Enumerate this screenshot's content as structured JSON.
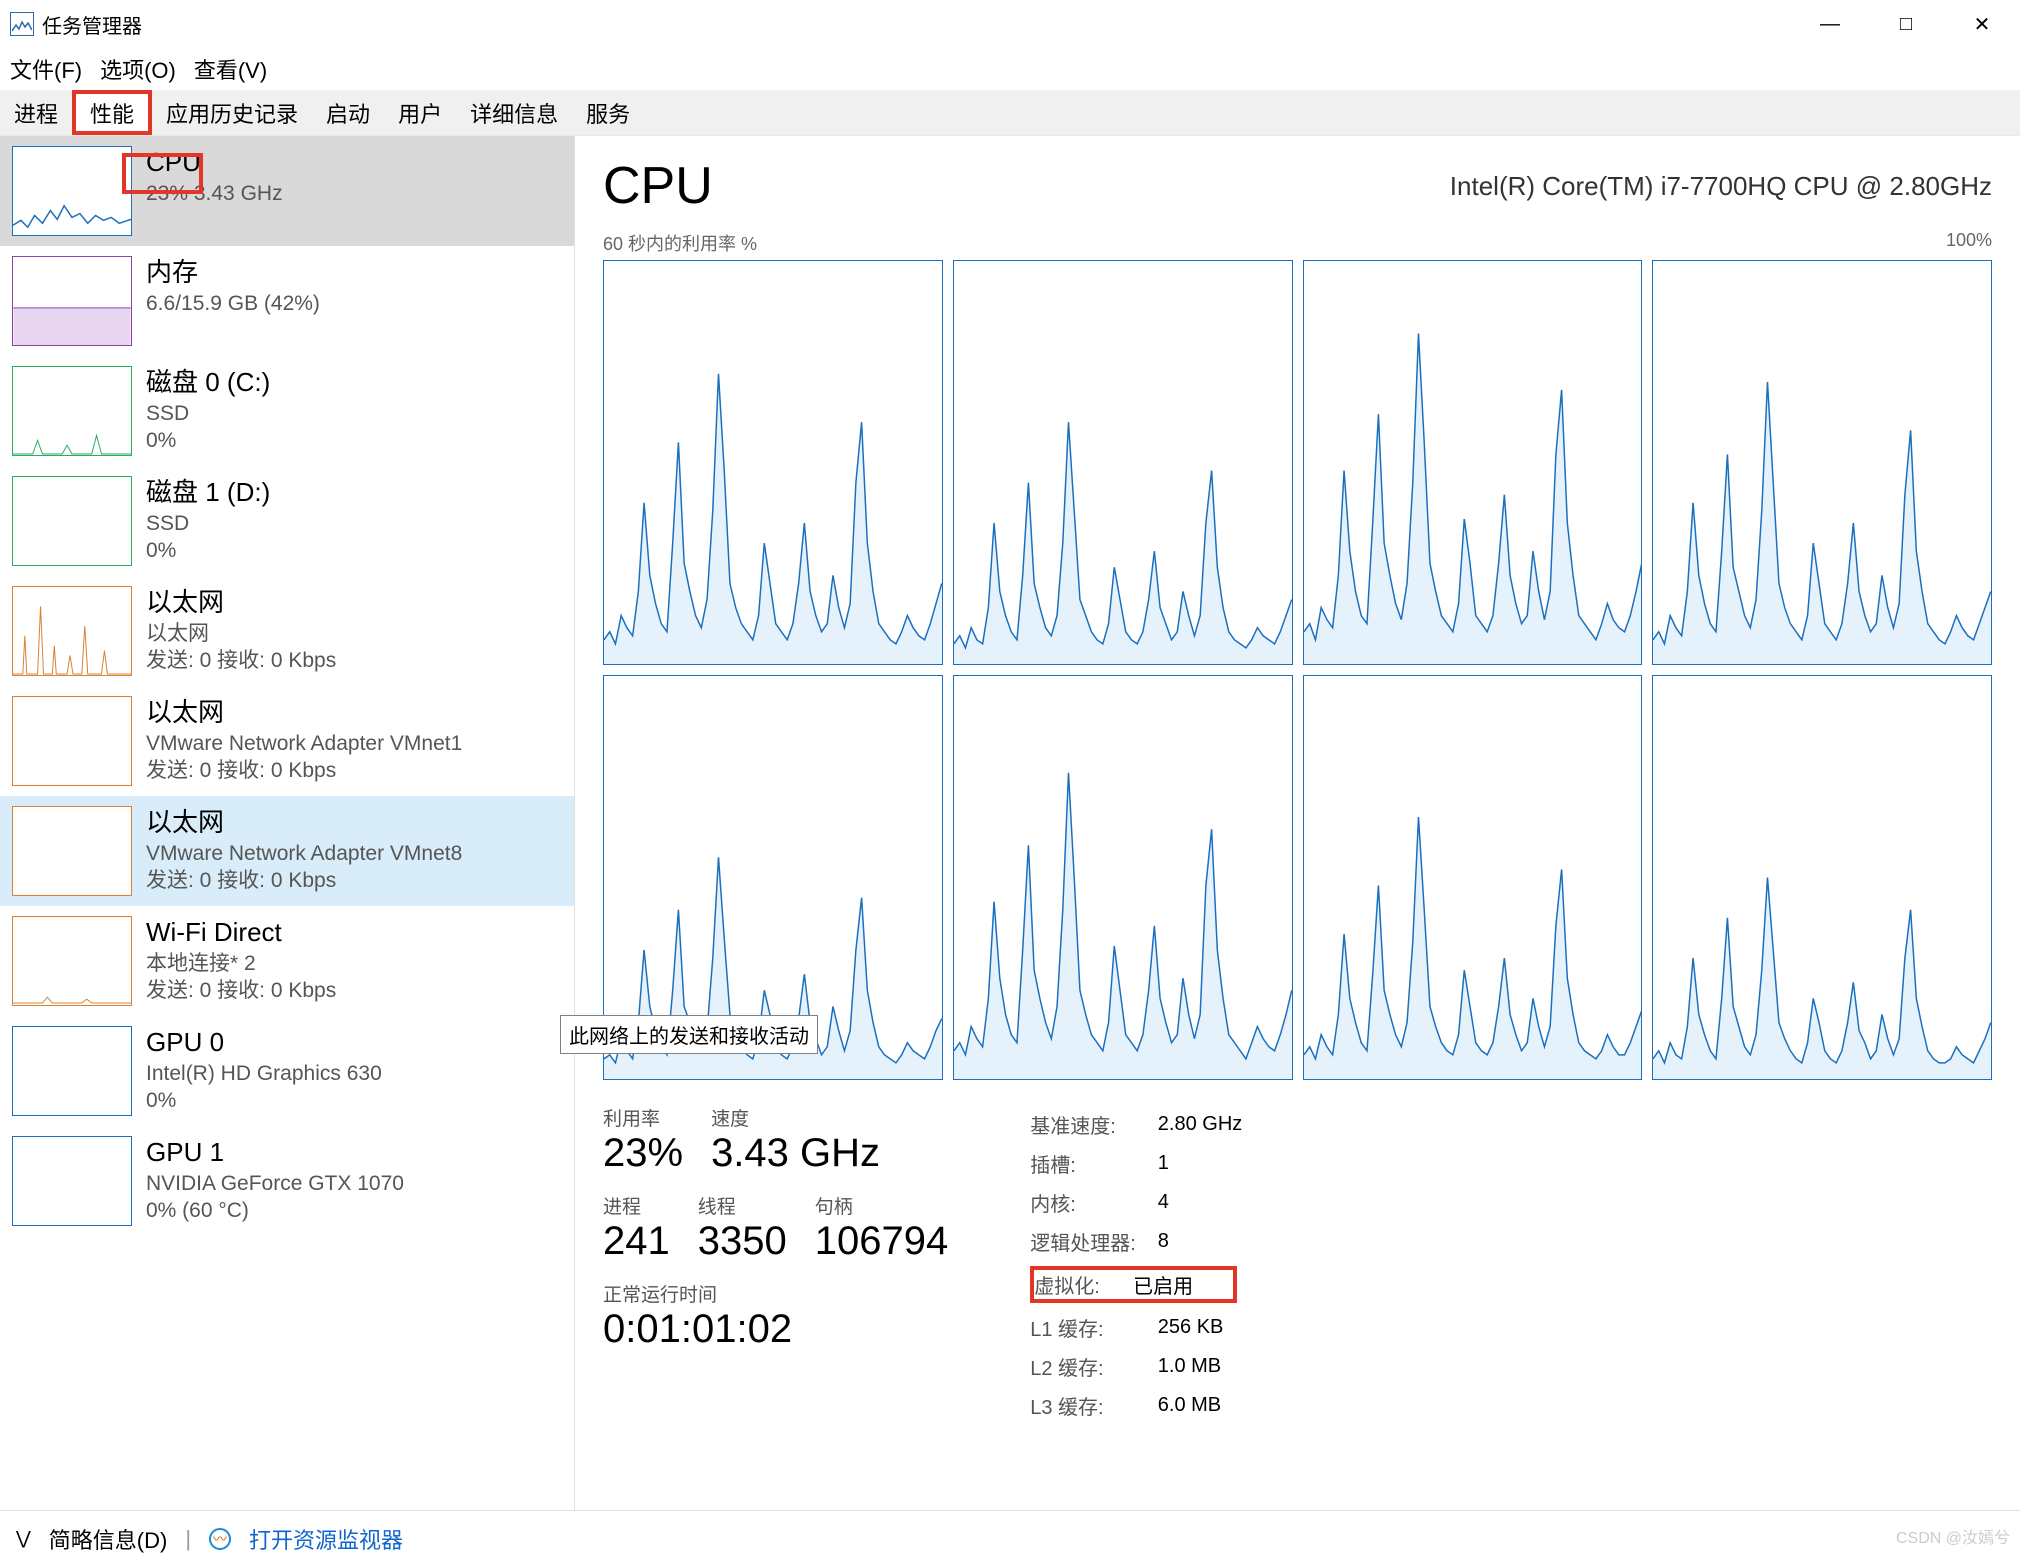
{
  "window": {
    "title": "任务管理器"
  },
  "win_controls": {
    "min": "—",
    "max": "□",
    "close": "✕"
  },
  "menu": {
    "file": "文件(F)",
    "options": "选项(O)",
    "view": "查看(V)"
  },
  "tabs": {
    "processes": "进程",
    "performance": "性能",
    "app_history": "应用历史记录",
    "startup": "启动",
    "users": "用户",
    "details": "详细信息",
    "services": "服务"
  },
  "sidebar": {
    "cpu": {
      "title": "CPU",
      "sub": "23% 3.43 GHz"
    },
    "mem": {
      "title": "内存",
      "sub": "6.6/15.9 GB (42%)"
    },
    "disk0": {
      "title": "磁盘 0 (C:)",
      "sub1": "SSD",
      "sub2": "0%"
    },
    "disk1": {
      "title": "磁盘 1 (D:)",
      "sub1": "SSD",
      "sub2": "0%"
    },
    "eth0": {
      "title": "以太网",
      "sub1": "以太网",
      "sub2": "发送: 0 接收: 0 Kbps"
    },
    "eth1": {
      "title": "以太网",
      "sub1": "VMware Network Adapter VMnet1",
      "sub2": "发送: 0 接收: 0 Kbps"
    },
    "eth2": {
      "title": "以太网",
      "sub1": "VMware Network Adapter VMnet8",
      "sub2": "发送: 0 接收: 0 Kbps"
    },
    "wifi": {
      "title": "Wi-Fi Direct",
      "sub1": "本地连接* 2",
      "sub2": "发送: 0 接收: 0 Kbps"
    },
    "gpu0": {
      "title": "GPU 0",
      "sub1": "Intel(R) HD Graphics 630",
      "sub2": "0%"
    },
    "gpu1": {
      "title": "GPU 1",
      "sub1": "NVIDIA GeForce GTX 1070",
      "sub2": "0% (60 °C)"
    }
  },
  "tooltip": "此网络上的发送和接收活动",
  "main": {
    "title": "CPU",
    "model": "Intel(R) Core(TM) i7-7700HQ CPU @ 2.80GHz",
    "graph_label": "60 秒内的利用率 %",
    "graph_max": "100%",
    "stats": {
      "util_label": "利用率",
      "util": "23%",
      "speed_label": "速度",
      "speed": "3.43 GHz",
      "proc_label": "进程",
      "proc": "241",
      "threads_label": "线程",
      "threads": "3350",
      "handles_label": "句柄",
      "handles": "106794",
      "uptime_label": "正常运行时间",
      "uptime": "0:01:01:02"
    },
    "right": {
      "base_label": "基准速度:",
      "base": "2.80 GHz",
      "sockets_label": "插槽:",
      "sockets": "1",
      "cores_label": "内核:",
      "cores": "4",
      "lp_label": "逻辑处理器:",
      "lp": "8",
      "virt_label": "虚拟化:",
      "virt": "已启用",
      "l1_label": "L1 缓存:",
      "l1": "256 KB",
      "l2_label": "L2 缓存:",
      "l2": "1.0 MB",
      "l3_label": "L3 缓存:",
      "l3": "6.0 MB"
    }
  },
  "footer": {
    "brief": "简略信息(D)",
    "resmon": "打开资源监视器"
  },
  "watermark": "CSDN @汝嫣兮",
  "chart_data": {
    "type": "line",
    "note": "8 per-logical-processor utilization sparklines over 60 seconds; values 0-100%",
    "xlabel": "60 秒内的利用率 %",
    "ylim": [
      0,
      100
    ],
    "series": [
      {
        "name": "LP0",
        "values": [
          6,
          8,
          5,
          12,
          9,
          7,
          18,
          40,
          22,
          15,
          10,
          8,
          30,
          55,
          25,
          18,
          12,
          9,
          16,
          38,
          72,
          48,
          20,
          14,
          10,
          8,
          6,
          12,
          30,
          20,
          10,
          8,
          6,
          10,
          20,
          35,
          18,
          12,
          8,
          10,
          22,
          14,
          9,
          15,
          45,
          60,
          30,
          18,
          10,
          8,
          6,
          5,
          8,
          12,
          9,
          7,
          6,
          10,
          15,
          20
        ]
      },
      {
        "name": "LP1",
        "values": [
          5,
          7,
          4,
          9,
          6,
          5,
          14,
          35,
          18,
          12,
          8,
          6,
          22,
          45,
          20,
          14,
          9,
          7,
          12,
          30,
          60,
          38,
          16,
          12,
          8,
          6,
          5,
          10,
          24,
          16,
          8,
          6,
          5,
          8,
          16,
          28,
          14,
          10,
          6,
          8,
          18,
          12,
          7,
          12,
          35,
          48,
          24,
          14,
          8,
          6,
          5,
          4,
          6,
          9,
          7,
          6,
          5,
          8,
          12,
          16
        ]
      },
      {
        "name": "LP2",
        "values": [
          8,
          10,
          6,
          14,
          11,
          9,
          22,
          48,
          28,
          18,
          12,
          10,
          35,
          62,
          30,
          22,
          15,
          11,
          20,
          45,
          82,
          55,
          25,
          18,
          12,
          10,
          8,
          15,
          36,
          25,
          12,
          10,
          8,
          12,
          25,
          42,
          22,
          15,
          10,
          12,
          28,
          18,
          11,
          18,
          52,
          68,
          35,
          22,
          12,
          10,
          8,
          6,
          10,
          15,
          11,
          9,
          8,
          12,
          18,
          25
        ]
      },
      {
        "name": "LP3",
        "values": [
          6,
          8,
          5,
          12,
          9,
          7,
          18,
          40,
          22,
          15,
          10,
          8,
          28,
          52,
          24,
          18,
          12,
          9,
          16,
          38,
          70,
          45,
          20,
          14,
          10,
          8,
          6,
          12,
          30,
          20,
          10,
          8,
          6,
          10,
          20,
          35,
          18,
          12,
          8,
          10,
          22,
          14,
          9,
          15,
          42,
          58,
          28,
          18,
          10,
          8,
          6,
          5,
          8,
          12,
          9,
          7,
          6,
          10,
          14,
          18
        ]
      },
      {
        "name": "LP4",
        "values": [
          5,
          6,
          4,
          10,
          7,
          5,
          14,
          32,
          18,
          12,
          8,
          6,
          22,
          42,
          18,
          14,
          9,
          7,
          12,
          30,
          55,
          35,
          16,
          12,
          8,
          6,
          5,
          10,
          22,
          16,
          8,
          6,
          5,
          8,
          15,
          26,
          14,
          10,
          6,
          8,
          18,
          12,
          7,
          12,
          32,
          45,
          22,
          14,
          8,
          6,
          5,
          4,
          6,
          9,
          7,
          6,
          5,
          8,
          12,
          15
        ]
      },
      {
        "name": "LP5",
        "values": [
          7,
          9,
          6,
          13,
          10,
          8,
          20,
          44,
          25,
          16,
          11,
          9,
          32,
          58,
          27,
          20,
          14,
          10,
          18,
          42,
          76,
          50,
          22,
          16,
          11,
          9,
          7,
          14,
          33,
          22,
          11,
          9,
          7,
          11,
          22,
          38,
          20,
          14,
          9,
          11,
          25,
          16,
          10,
          16,
          48,
          62,
          32,
          20,
          11,
          9,
          7,
          5,
          9,
          13,
          10,
          8,
          7,
          11,
          16,
          22
        ]
      },
      {
        "name": "LP6",
        "values": [
          6,
          8,
          5,
          11,
          8,
          6,
          16,
          36,
          20,
          14,
          9,
          7,
          26,
          48,
          22,
          16,
          11,
          8,
          14,
          34,
          65,
          42,
          18,
          13,
          9,
          7,
          6,
          11,
          27,
          18,
          9,
          7,
          6,
          9,
          18,
          30,
          16,
          11,
          7,
          9,
          20,
          13,
          8,
          13,
          38,
          52,
          25,
          16,
          9,
          7,
          6,
          5,
          7,
          11,
          8,
          6,
          6,
          9,
          13,
          17
        ]
      },
      {
        "name": "LP7",
        "values": [
          5,
          7,
          4,
          9,
          6,
          5,
          13,
          30,
          16,
          11,
          7,
          5,
          20,
          40,
          18,
          13,
          8,
          6,
          11,
          27,
          50,
          32,
          14,
          10,
          7,
          5,
          4,
          9,
          20,
          14,
          7,
          5,
          4,
          7,
          14,
          24,
          12,
          9,
          5,
          7,
          16,
          10,
          6,
          10,
          30,
          42,
          20,
          13,
          7,
          5,
          4,
          4,
          5,
          8,
          6,
          5,
          4,
          7,
          10,
          14
        ]
      }
    ]
  }
}
